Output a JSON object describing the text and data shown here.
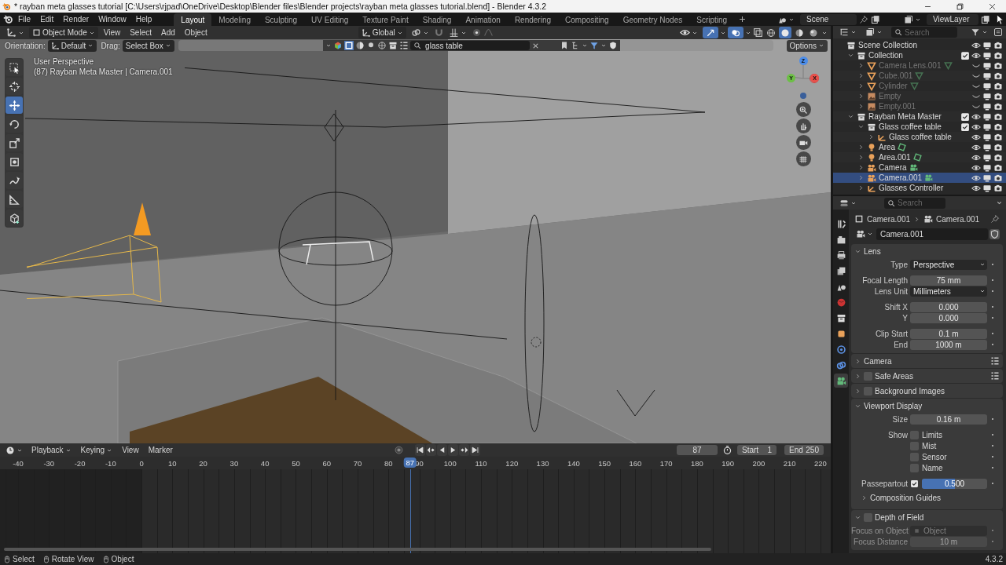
{
  "window": {
    "title": "* rayban meta glasses tutorial [C:\\Users\\rjpad\\OneDrive\\Desktop\\Blender files\\Blender projects\\rayban meta glasses tutorial.blend] - Blender 4.3.2"
  },
  "menu": [
    "File",
    "Edit",
    "Render",
    "Window",
    "Help"
  ],
  "workspaces": [
    {
      "label": "Layout",
      "selected": true
    },
    {
      "label": "Modeling",
      "selected": false
    },
    {
      "label": "Sculpting",
      "selected": false
    },
    {
      "label": "UV Editing",
      "selected": false
    },
    {
      "label": "Texture Paint",
      "selected": false
    },
    {
      "label": "Shading",
      "selected": false
    },
    {
      "label": "Animation",
      "selected": false
    },
    {
      "label": "Rendering",
      "selected": false
    },
    {
      "label": "Compositing",
      "selected": false
    },
    {
      "label": "Geometry Nodes",
      "selected": false
    },
    {
      "label": "Scripting",
      "selected": false
    }
  ],
  "scene": "Scene",
  "view_layer": "ViewLayer",
  "viewport": {
    "mode": "Object Mode",
    "menus": [
      "View",
      "Select",
      "Add",
      "Object"
    ],
    "orientation": "Global",
    "tool_settings": {
      "orientation_label": "Orientation:",
      "orientation": "Default",
      "drag_label": "Drag:",
      "drag": "Select Box",
      "search": "glass table",
      "options": "Options"
    },
    "overlay_lines": [
      "User Perspective",
      "(87) Rayban Meta Master | Camera.001"
    ],
    "gizmo_axes": [
      "Z",
      "Y",
      "X"
    ],
    "tools": [
      {
        "kind": "select",
        "selected": false
      },
      {
        "kind": "cursor",
        "selected": false
      },
      {
        "kind": "move",
        "selected": true
      },
      {
        "kind": "rotate",
        "selected": false
      },
      {
        "kind": "scale",
        "selected": false
      },
      {
        "kind": "transform",
        "selected": false
      },
      {
        "kind": "annotate",
        "selected": false
      },
      {
        "kind": "measure",
        "selected": false
      },
      {
        "kind": "add-cube",
        "selected": false
      }
    ],
    "shading": [
      {
        "kind": "wireframe",
        "selected": false
      },
      {
        "kind": "solid",
        "selected": true
      },
      {
        "kind": "material",
        "selected": false
      },
      {
        "kind": "rendered",
        "selected": false
      }
    ]
  },
  "timeline": {
    "menus": [
      {
        "label": "Playback",
        "dropdown": true
      },
      {
        "label": "Keying",
        "dropdown": true
      },
      {
        "label": "View",
        "dropdown": false
      },
      {
        "label": "Marker",
        "dropdown": false
      }
    ],
    "current_frame": "87",
    "start_label": "Start",
    "start": "1",
    "end_label": "End",
    "end": "250",
    "ticks": [
      "-40",
      "-30",
      "-20",
      "-10",
      "0",
      "10",
      "20",
      "30",
      "40",
      "50",
      "60",
      "70",
      "80",
      "90",
      "100",
      "110",
      "120",
      "130",
      "140",
      "150",
      "160",
      "170",
      "180",
      "190",
      "200",
      "210",
      "220"
    ],
    "playhead": "87"
  },
  "outliner": {
    "search_placeholder": "Search",
    "tree": [
      {
        "name": "Scene Collection",
        "kind": "scene-collection",
        "selected": false,
        "hidden": false,
        "children": [
          {
            "name": "Collection",
            "kind": "collection",
            "expanded": true,
            "checked": true,
            "selected": false,
            "hidden": false,
            "children": [
              {
                "name": "Camera Lens.001",
                "kind": "mesh",
                "expanded": false,
                "selected": false,
                "hidden": true
              },
              {
                "name": "Cube.001",
                "kind": "mesh",
                "expanded": false,
                "selected": false,
                "hidden": true
              },
              {
                "name": "Cylinder",
                "kind": "mesh",
                "expanded": false,
                "selected": false,
                "hidden": true
              },
              {
                "name": "Empty",
                "kind": "image-empty",
                "expanded": false,
                "selected": false,
                "hidden": true
              },
              {
                "name": "Empty.001",
                "kind": "image-empty",
                "expanded": false,
                "selected": false,
                "hidden": true
              }
            ]
          },
          {
            "name": "Rayban Meta Master",
            "kind": "collection",
            "expanded": true,
            "checked": true,
            "selected": false,
            "hidden": false,
            "children": [
              {
                "name": "Glass coffee table",
                "kind": "collection",
                "expanded": true,
                "checked": true,
                "selected": false,
                "hidden": false,
                "children": [
                  {
                    "name": "Glass coffee table",
                    "kind": "empty",
                    "expanded": false,
                    "selected": false,
                    "hidden": false
                  }
                ]
              },
              {
                "name": "Area",
                "kind": "light",
                "expanded": false,
                "selected": false,
                "hidden": false
              },
              {
                "name": "Area.001",
                "kind": "light",
                "expanded": false,
                "selected": false,
                "hidden": false
              },
              {
                "name": "Camera",
                "kind": "camera",
                "expanded": false,
                "selected": false,
                "hidden": false
              },
              {
                "name": "Camera.001",
                "kind": "camera",
                "expanded": false,
                "selected": true,
                "hidden": false
              },
              {
                "name": "Glasses Controller",
                "kind": "empty",
                "expanded": false,
                "selected": false,
                "hidden": false
              }
            ]
          }
        ]
      }
    ]
  },
  "properties": {
    "search_placeholder": "Search",
    "tabs": [
      {
        "kind": "tool",
        "selected": false
      },
      {
        "kind": "render",
        "selected": false
      },
      {
        "kind": "output",
        "selected": false
      },
      {
        "kind": "view-layer",
        "selected": false
      },
      {
        "kind": "scene",
        "selected": false
      },
      {
        "kind": "world",
        "selected": false
      },
      {
        "kind": "collection",
        "selected": false
      },
      {
        "kind": "object",
        "selected": false
      },
      {
        "kind": "physics",
        "selected": false
      },
      {
        "kind": "constraint",
        "selected": false
      },
      {
        "kind": "data",
        "selected": true
      }
    ],
    "breadcrumb": [
      "Camera.001",
      "Camera.001"
    ],
    "data_block": "Camera.001",
    "panels": [
      {
        "title": "Lens",
        "expanded": true,
        "presets": false,
        "groups": [
          [
            {
              "kind": "dropdown",
              "label": "Type",
              "value": "Perspective"
            }
          ],
          [
            {
              "kind": "number",
              "label": "Focal Length",
              "value": "75 mm"
            },
            {
              "kind": "dropdown",
              "label": "Lens Unit",
              "value": "Millimeters"
            }
          ],
          [
            {
              "kind": "number",
              "label": "Shift X",
              "value": "0.000"
            },
            {
              "kind": "number",
              "label": "Y",
              "value": "0.000"
            }
          ],
          [
            {
              "kind": "number",
              "label": "Clip Start",
              "value": "0.1 m"
            },
            {
              "kind": "number",
              "label": "End",
              "value": "1000 m"
            }
          ]
        ]
      },
      {
        "title": "Camera",
        "expanded": false,
        "presets": true
      },
      {
        "title": "Safe Areas",
        "expanded": false,
        "checked": false,
        "presets": true
      },
      {
        "title": "Background Images",
        "expanded": false,
        "checked": false,
        "presets": false
      },
      {
        "title": "Viewport Display",
        "expanded": true,
        "presets": false,
        "groups": [
          [
            {
              "kind": "number",
              "label": "Size",
              "value": "0.16 m"
            }
          ],
          [
            {
              "kind": "checkbox",
              "label": "Show",
              "text": "Limits",
              "checked": false
            },
            {
              "kind": "checkbox",
              "text": "Mist",
              "checked": false
            },
            {
              "kind": "checkbox",
              "text": "Sensor",
              "checked": false
            },
            {
              "kind": "checkbox",
              "text": "Name",
              "checked": false
            }
          ],
          [
            {
              "kind": "slider",
              "label": "Passepartout",
              "checked": true,
              "level": 0.5,
              "value": "0.500"
            }
          ]
        ],
        "subpanels": [
          {
            "title": "Composition Guides",
            "expanded": false
          }
        ]
      },
      {
        "title": "Depth of Field",
        "expanded": true,
        "checked": false,
        "presets": false,
        "groups": [
          [
            {
              "kind": "object-field",
              "label": "Focus on Object",
              "placeholder": "Object",
              "disabled": true
            },
            {
              "kind": "number",
              "label": "Focus Distance",
              "value": "10 m",
              "disabled": true
            }
          ]
        ]
      }
    ]
  },
  "status_bar": {
    "items": [
      "Select",
      "Rotate View",
      "Object"
    ],
    "version": "4.3.2"
  }
}
